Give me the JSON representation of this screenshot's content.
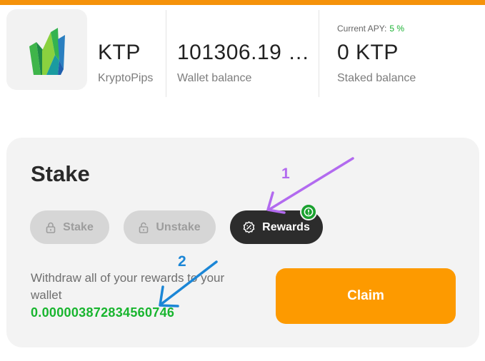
{
  "colors": {
    "brand": "#f5920a",
    "apy_green": "#1bb233",
    "claim_button": "#fd9a00",
    "active_tab": "#2c2c2c",
    "annotation_purple": "#b26aef",
    "annotation_blue": "#1b86d6"
  },
  "token": {
    "logo_icon": "crystal-logo-icon",
    "symbol": "KTP",
    "name": "KryptoPips"
  },
  "wallet": {
    "amount": "101306.19 …",
    "label": "Wallet balance"
  },
  "staked": {
    "apy_label": "Current APY:",
    "apy_value": "5 %",
    "amount": "0 KTP",
    "label": "Staked balance"
  },
  "stake_card": {
    "title": "Stake",
    "tabs": [
      {
        "label": "Stake",
        "icon": "lock-icon",
        "state": "disabled"
      },
      {
        "label": "Unstake",
        "icon": "unlock-icon",
        "state": "disabled"
      },
      {
        "label": "Rewards",
        "icon": "rewards-badge-icon",
        "state": "active"
      }
    ],
    "rewards_notification_icon": "alert-icon",
    "withdraw_text": "Withdraw all of your rewards to your wallet",
    "reward_amount": "0.000003872834560746",
    "claim_label": "Claim"
  },
  "annotations": [
    {
      "number": "1",
      "color": "#b26aef"
    },
    {
      "number": "2",
      "color": "#1b86d6"
    }
  ]
}
